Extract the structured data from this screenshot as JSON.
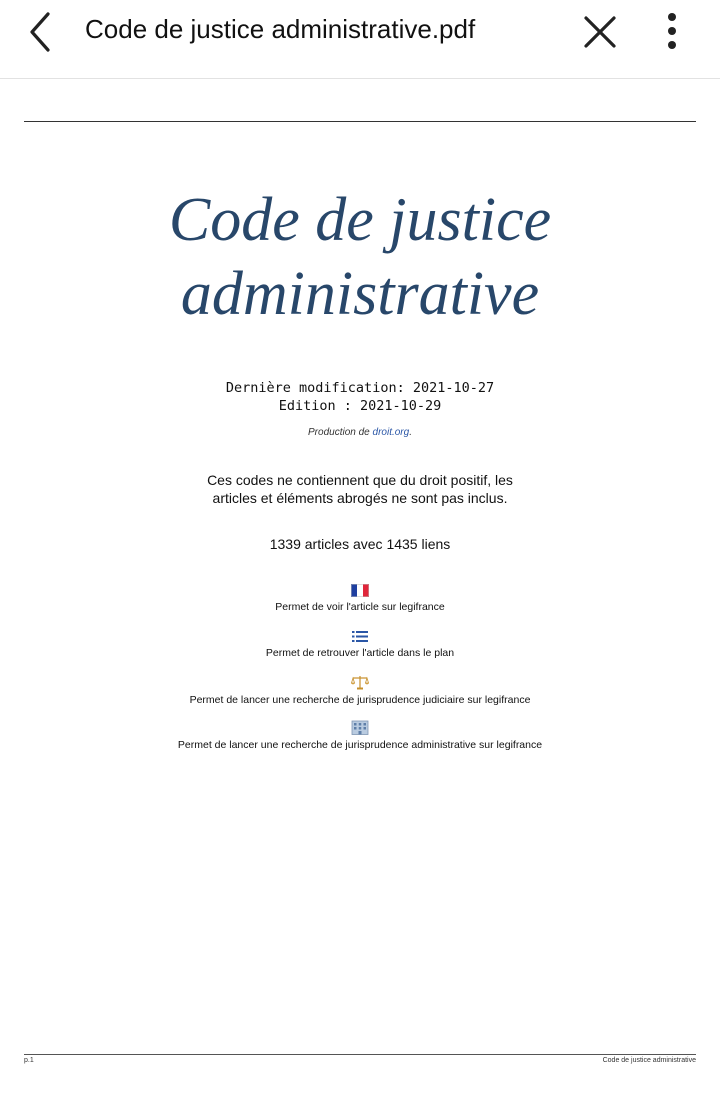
{
  "appbar": {
    "title": "Code de justice administrative.pdf"
  },
  "document": {
    "title_line1": "Code de justice",
    "title_line2": "administrative",
    "last_modified": "Dernière modification: 2021-10-27",
    "edition": "Edition : 2021-10-29",
    "production_prefix": "Production de ",
    "production_link": "droit.org",
    "production_suffix": ".",
    "intro_line1": "Ces codes ne contiennent que du droit positif, les",
    "intro_line2": "articles et éléments abrogés ne sont pas inclus.",
    "count": "1339 articles avec 1435 liens",
    "legend": [
      {
        "icon": "french-flag-icon",
        "text": "Permet de voir l'article sur legifrance"
      },
      {
        "icon": "list-icon",
        "text": "Permet de retrouver l'article dans le plan"
      },
      {
        "icon": "scales-of-justice-icon",
        "text": "Permet de lancer une recherche de jurisprudence judiciaire sur legifrance"
      },
      {
        "icon": "building-icon",
        "text": "Permet de lancer une recherche de jurisprudence administrative sur legifrance"
      }
    ]
  },
  "footer": {
    "page_label": "p.1",
    "doc_name": "Code de justice administrative"
  },
  "colors": {
    "title": "#28476a",
    "link": "#2a56a6"
  }
}
